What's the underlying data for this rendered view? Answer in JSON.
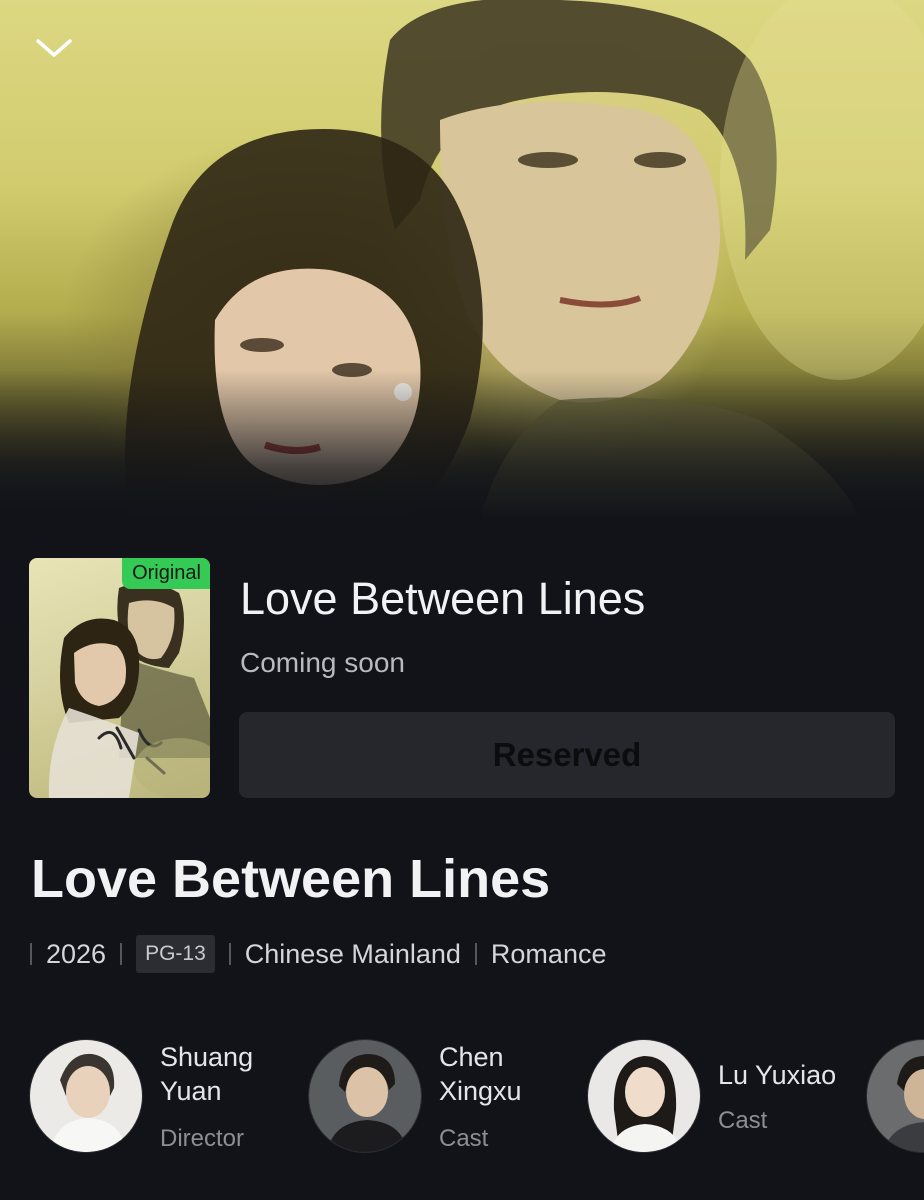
{
  "hero": {
    "collapse_icon": "chevron-down-icon"
  },
  "show": {
    "badge": "Original",
    "title": "Love Between Lines",
    "status": "Coming soon",
    "reserve_label": "Reserved",
    "big_title": "Love Between Lines",
    "meta": {
      "year": "2026",
      "rating": "PG-13",
      "region": "Chinese Mainland",
      "genre": "Romance"
    }
  },
  "cast": [
    {
      "name_line1": "Shuang",
      "name_line2": "Yuan",
      "role": "Director"
    },
    {
      "name_line1": "Chen",
      "name_line2": "Xingxu",
      "role": "Cast"
    },
    {
      "name_line1": "Lu Yuxiao",
      "role": "Cast"
    }
  ],
  "colors": {
    "background": "#111319",
    "badge_green": "#35c955",
    "button_bg": "#25272d"
  }
}
